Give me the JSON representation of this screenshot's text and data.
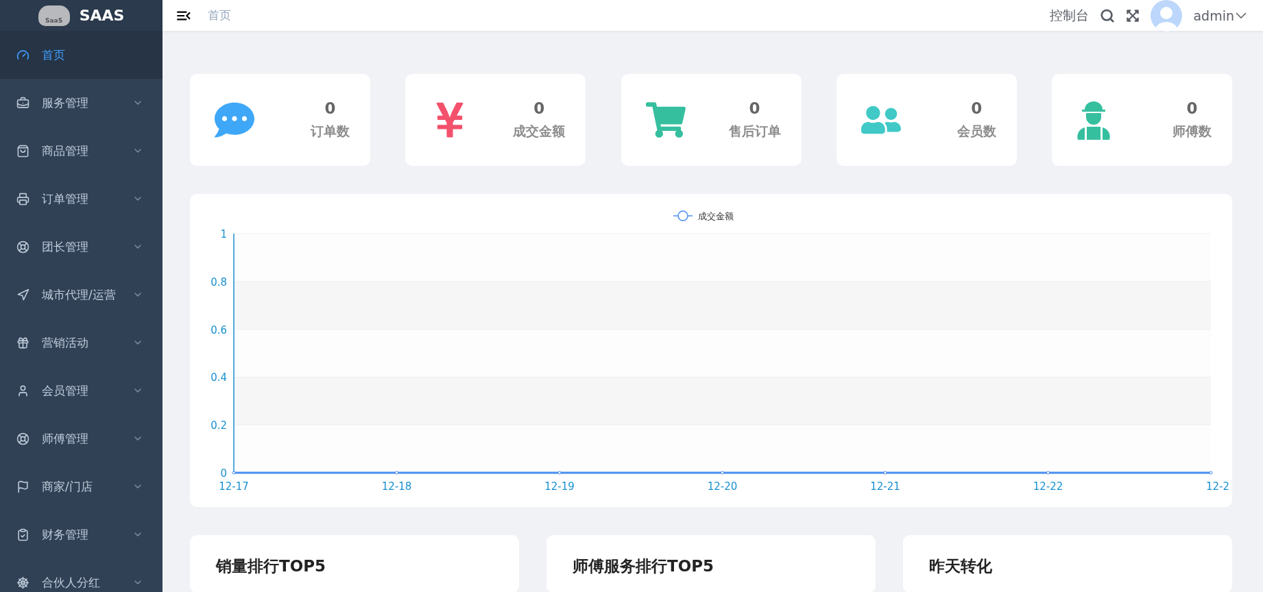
{
  "brand": {
    "logo_text": "SaaS",
    "name": "SAAS"
  },
  "sidebar": {
    "items": [
      {
        "label": "首页",
        "selected": true,
        "has_submenu": false
      },
      {
        "label": "服务管理",
        "selected": false,
        "has_submenu": true
      },
      {
        "label": "商品管理",
        "selected": false,
        "has_submenu": true
      },
      {
        "label": "订单管理",
        "selected": false,
        "has_submenu": true
      },
      {
        "label": "团长管理",
        "selected": false,
        "has_submenu": true
      },
      {
        "label": "城市代理/运营",
        "selected": false,
        "has_submenu": true
      },
      {
        "label": "营销活动",
        "selected": false,
        "has_submenu": true
      },
      {
        "label": "会员管理",
        "selected": false,
        "has_submenu": true
      },
      {
        "label": "师傅管理",
        "selected": false,
        "has_submenu": true
      },
      {
        "label": "商家/门店",
        "selected": false,
        "has_submenu": true
      },
      {
        "label": "财务管理",
        "selected": false,
        "has_submenu": true
      },
      {
        "label": "合伙人分红",
        "selected": false,
        "has_submenu": true
      }
    ]
  },
  "header": {
    "breadcrumb": "首页",
    "console": "控制台",
    "user": "admin"
  },
  "stats": [
    {
      "value": "0",
      "label": "订单数",
      "color": "#3fa7f7"
    },
    {
      "value": "0",
      "label": "成交金额",
      "color": "#f4516c"
    },
    {
      "value": "0",
      "label": "售后订单",
      "color": "#36bf9f"
    },
    {
      "value": "0",
      "label": "会员数",
      "color": "#40c9c6"
    },
    {
      "value": "0",
      "label": "师傅数",
      "color": "#36bf9f"
    }
  ],
  "chart": {
    "chart_data": {
      "type": "line",
      "categories": [
        "12-17",
        "12-18",
        "12-19",
        "12-20",
        "12-21",
        "12-22",
        "12-2"
      ],
      "series": [
        {
          "name": "成交金额",
          "color": "#4a8ef2",
          "marker": "circle",
          "values": [
            0,
            0,
            0,
            0,
            0,
            0,
            0
          ]
        }
      ],
      "grid": true,
      "ylim": [
        0,
        1
      ],
      "yticks": [
        0,
        0.2,
        0.4,
        0.6,
        0.8,
        1
      ]
    }
  },
  "panels": [
    {
      "title": "销量排行TOP5"
    },
    {
      "title": "师傅服务排行TOP5"
    },
    {
      "title": "昨天转化"
    }
  ]
}
